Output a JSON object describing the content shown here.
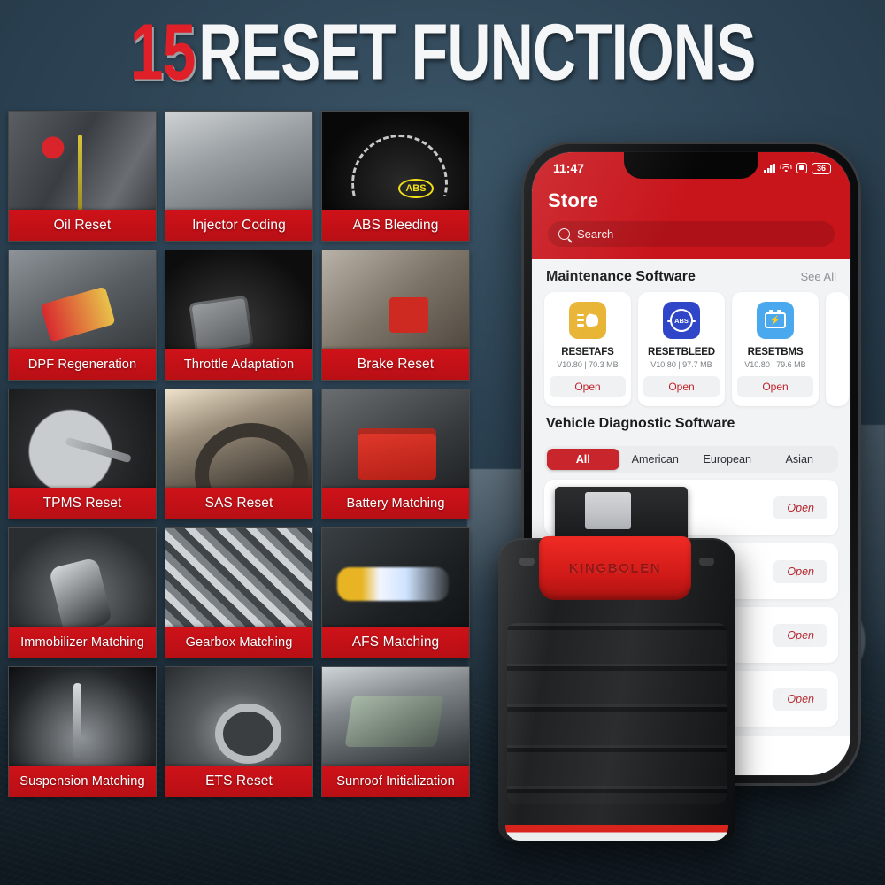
{
  "header": {
    "number": "15",
    "title": "RESET FUNCTIONS"
  },
  "colors": {
    "brand_red": "#c8151c",
    "band_red": "#cf1219",
    "background_slate": "#2d4354",
    "open_link": "#b2232b"
  },
  "functions": [
    {
      "label": "Oil Reset",
      "photo": "ph-oil"
    },
    {
      "label": "Injector Coding",
      "photo": "ph-inj"
    },
    {
      "label": "ABS Bleeding",
      "photo": "ph-abs"
    },
    {
      "label": "DPF Regeneration",
      "photo": "ph-dpf"
    },
    {
      "label": "Throttle Adaptation",
      "photo": "ph-thr"
    },
    {
      "label": "Brake Reset",
      "photo": "ph-brk"
    },
    {
      "label": "TPMS Reset",
      "photo": "ph-tpms"
    },
    {
      "label": "SAS Reset",
      "photo": "ph-sas"
    },
    {
      "label": "Battery Matching",
      "photo": "ph-bat"
    },
    {
      "label": "Immobilizer Matching",
      "photo": "ph-imm"
    },
    {
      "label": "Gearbox Matching",
      "photo": "ph-gbx"
    },
    {
      "label": "AFS Matching",
      "photo": "ph-afs"
    },
    {
      "label": "Suspension Matching",
      "photo": "ph-sus"
    },
    {
      "label": "ETS Reset",
      "photo": "ph-ets"
    },
    {
      "label": "Sunroof Initialization",
      "photo": "ph-sun"
    }
  ],
  "phone": {
    "status_bar": {
      "time": "11:47",
      "battery_level": "36",
      "icons": [
        "signal-icon",
        "wifi-icon",
        "screen-record-icon",
        "battery-icon"
      ]
    },
    "app_bar": {
      "title": "Store",
      "search_placeholder": "Search",
      "search_icon": "search-icon"
    },
    "maintenance_section": {
      "title": "Maintenance Software",
      "see_all": "See All",
      "apps": [
        {
          "name": "RESETAFS",
          "meta": "V10.80 | 70.3 MB",
          "open": "Open",
          "icon": "headlight-icon",
          "icon_class": "afs"
        },
        {
          "name": "RESETBLEED",
          "meta": "V10.80 | 97.7 MB",
          "open": "Open",
          "icon": "abs-icon",
          "icon_class": "bleed"
        },
        {
          "name": "RESETBMS",
          "meta": "V10.80 | 79.6 MB",
          "open": "Open",
          "icon": "battery-icon",
          "icon_class": "bms"
        }
      ]
    },
    "vehicle_section": {
      "title": "Vehicle Diagnostic Software",
      "filters": [
        {
          "label": "All",
          "active": true
        },
        {
          "label": "American",
          "active": false
        },
        {
          "label": "European",
          "active": false
        },
        {
          "label": "Asian",
          "active": false
        }
      ],
      "rows": [
        {
          "open": "Open"
        },
        {
          "open": "Open"
        },
        {
          "open": "Open"
        },
        {
          "open": "Open"
        }
      ]
    },
    "nav_bar": {
      "icon": "person-icon"
    }
  },
  "device": {
    "brand": "KINGBOLEN"
  }
}
